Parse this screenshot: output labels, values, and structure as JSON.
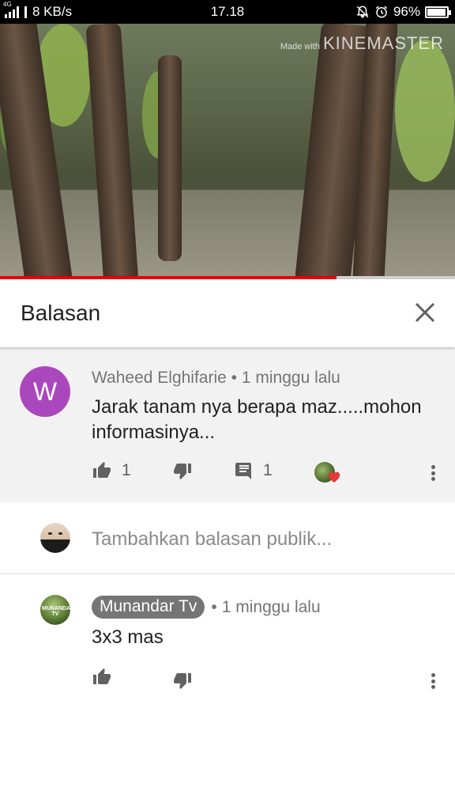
{
  "status_bar": {
    "network_type": "4G",
    "speed": "8 KB/s",
    "time": "17.18",
    "battery": "96%",
    "battery_level": 0.96
  },
  "video": {
    "watermark_small": "Made with",
    "watermark_brand": "KINEMASTER",
    "progress_fraction": 0.74
  },
  "panel": {
    "title": "Balasan",
    "close_icon": "close-icon"
  },
  "parent_comment": {
    "avatar_letter": "W",
    "avatar_color": "#ab47bc",
    "author": "Waheed Elghifarie",
    "separator": "•",
    "time": "1 minggu lalu",
    "text": "Jarak tanam nya berapa maz.....mohon informasinya...",
    "likes": "1",
    "replies": "1",
    "icons": [
      "thumb-up-icon",
      "thumb-down-icon",
      "comment-icon",
      "creator-heart-icon",
      "more-vert-icon"
    ]
  },
  "add_reply": {
    "placeholder": "Tambahkan balasan publik..."
  },
  "reply": {
    "author": "Munandar Tv",
    "avatar_text": "MUNANDAR TV",
    "separator": "•",
    "time": "1 minggu lalu",
    "text": "3x3 mas"
  },
  "colors": {
    "progress_played": "#ee0000",
    "heart": "#e53935",
    "chip_bg": "#757575"
  }
}
